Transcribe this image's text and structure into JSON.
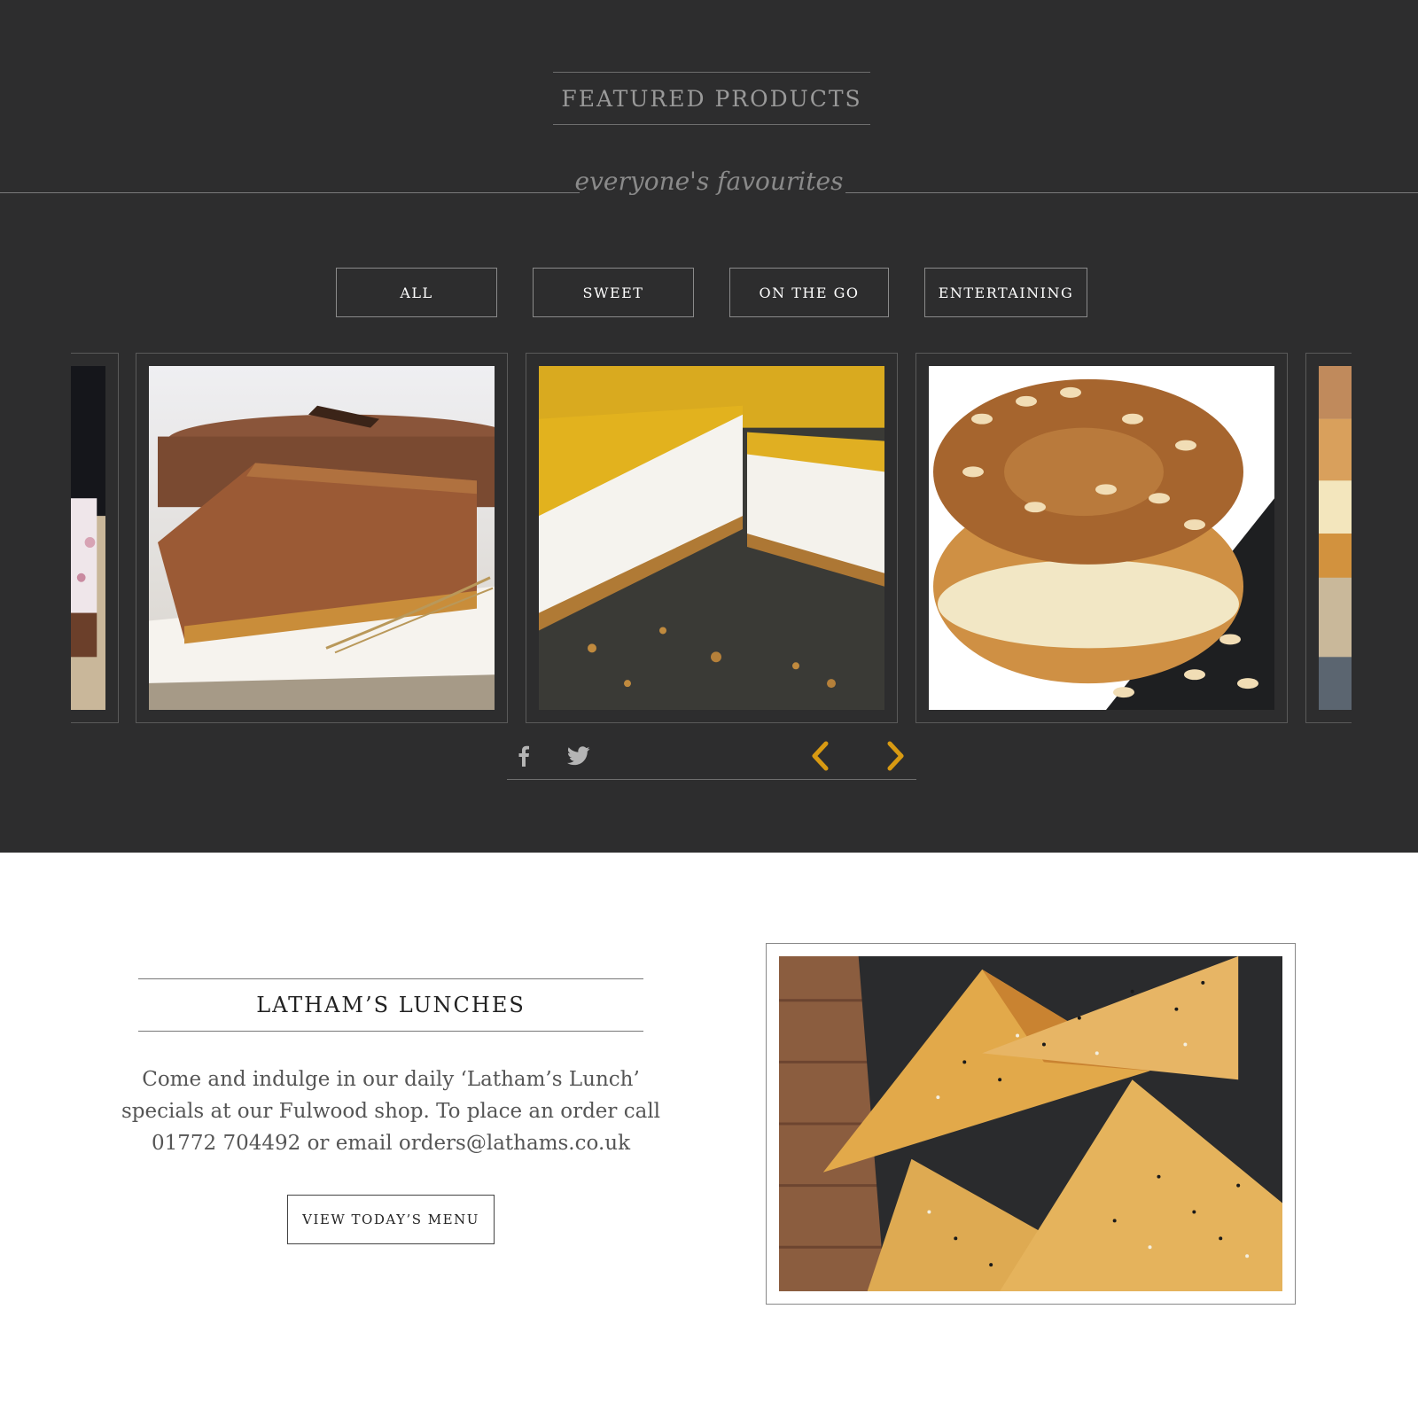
{
  "featured": {
    "title": "FEATURED PRODUCTS",
    "tagline": "everyone's favourites",
    "filters": [
      {
        "label": "ALL"
      },
      {
        "label": "SWEET"
      },
      {
        "label": "ON THE GO"
      },
      {
        "label": "ENTERTAINING"
      }
    ],
    "carousel": {
      "items": [
        {
          "image": "layer-cake-partial"
        },
        {
          "image": "chocolate-mousse-cake-slice"
        },
        {
          "image": "passion-fruit-cheesecake"
        },
        {
          "image": "almond-paris-brest-pastry"
        },
        {
          "image": "pastry-partial"
        }
      ],
      "social": [
        "facebook-icon",
        "twitter-icon"
      ],
      "arrow_color": "#d89a12"
    }
  },
  "lunches": {
    "title": "LATHAM’S LUNCHES",
    "text": "Come and indulge in our daily ‘Latham’s Lunch’ specials at our Fulwood shop. To place an order call 01772 704492 or email orders@lathams.co.uk",
    "button_label": "VIEW TODAY’S MENU",
    "image": "filo-pastry-triangles"
  },
  "colors": {
    "dark_bg": "#2d2d2e",
    "accent": "#d89a12"
  }
}
